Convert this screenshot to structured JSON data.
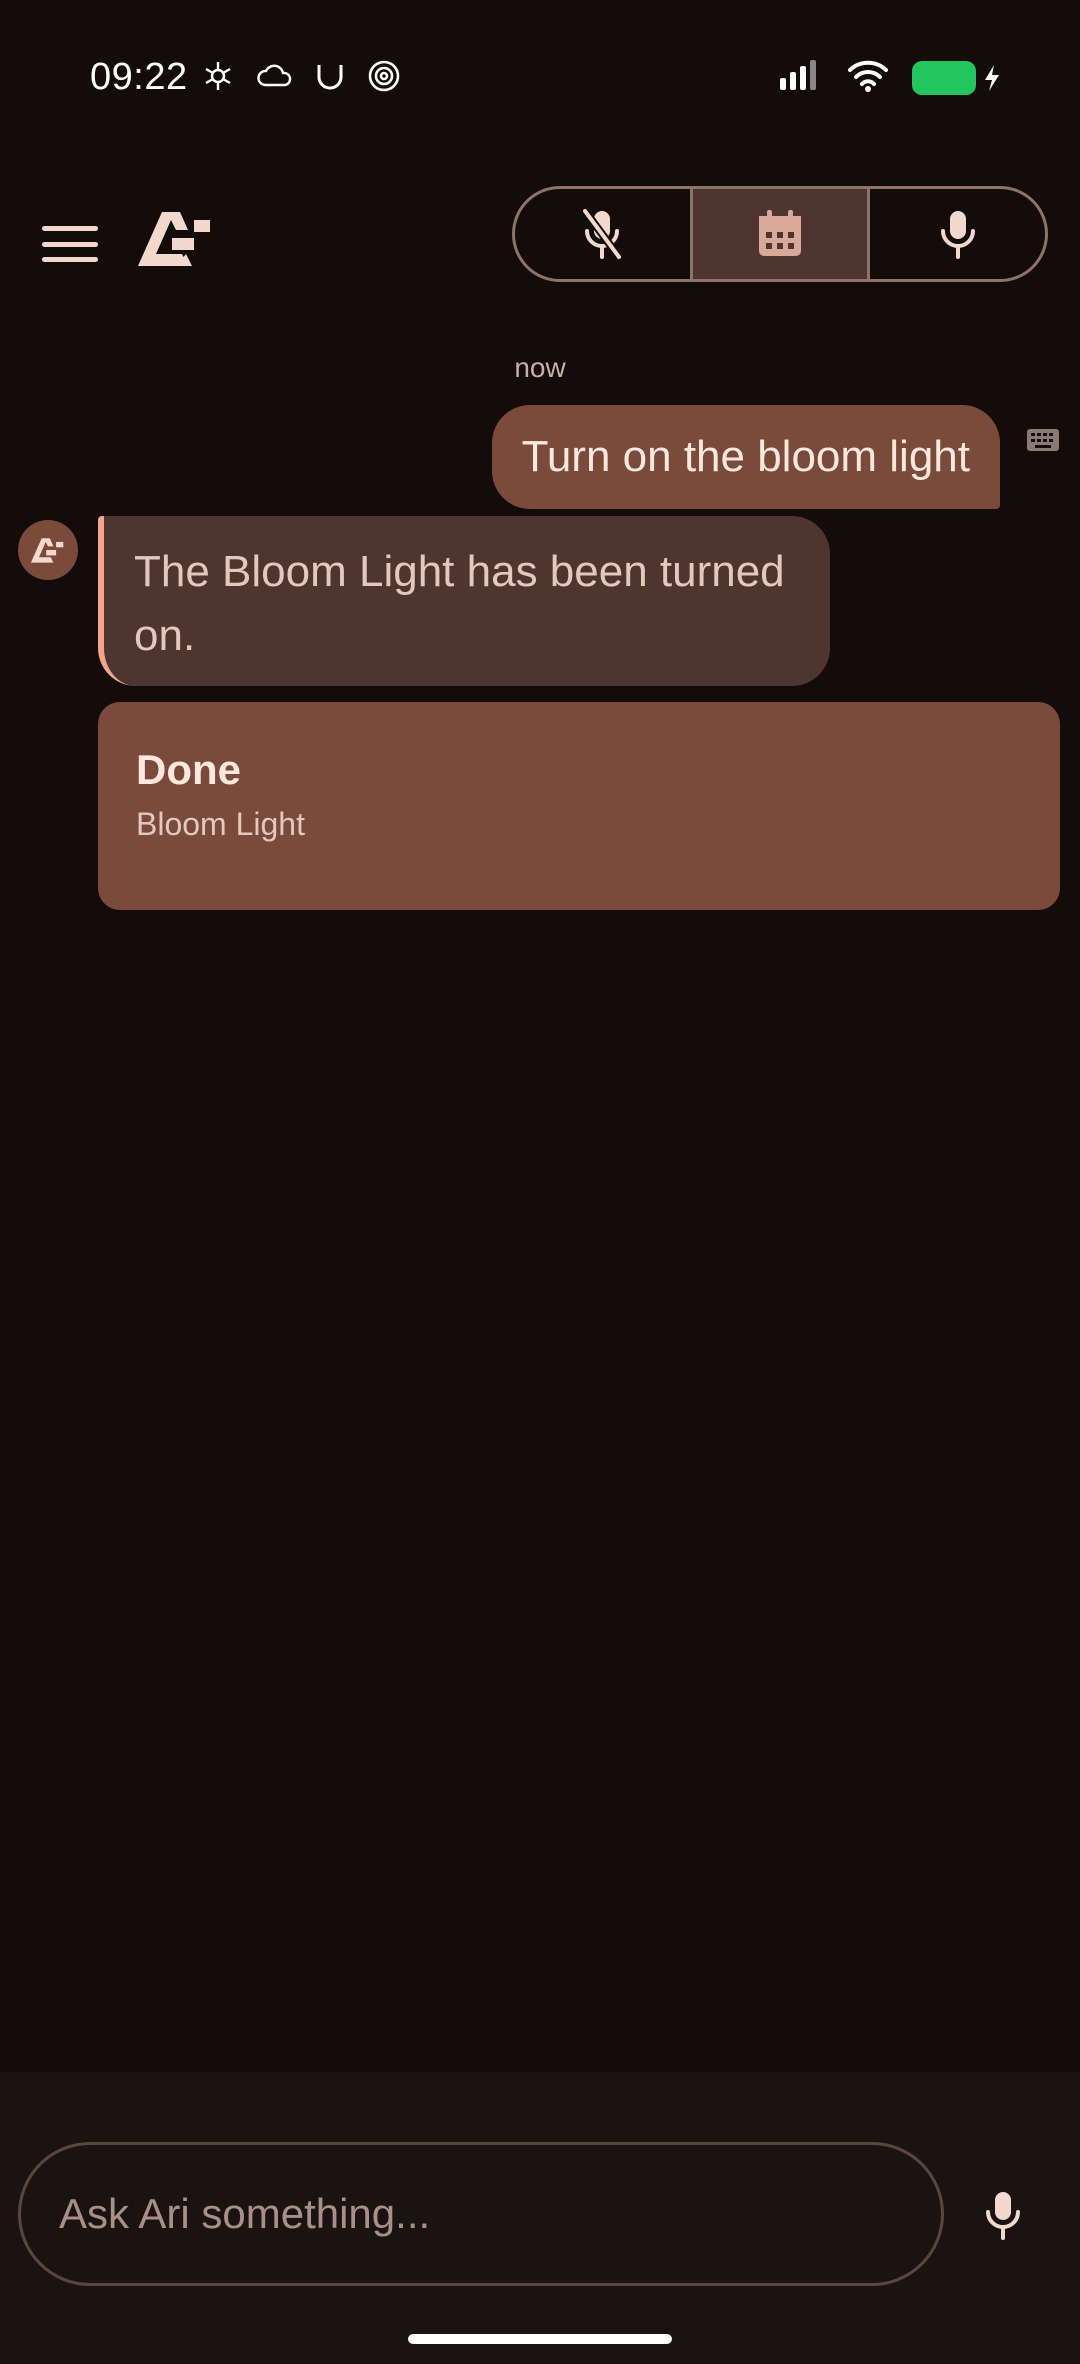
{
  "status_bar": {
    "time": "09:22",
    "left_icons": [
      "openai-icon",
      "cloud-icon",
      "u-app-icon",
      "spiral-icon"
    ],
    "right_icons": [
      "signal-icon",
      "wifi-icon",
      "battery-charging-icon"
    ],
    "battery_color": "#22c55e"
  },
  "header": {
    "menu_icon": "hamburger-menu-icon",
    "logo_icon": "ari-logo-icon",
    "mode_buttons": [
      {
        "name": "mic-muted",
        "icon": "mic-off-icon",
        "active": false
      },
      {
        "name": "calendar",
        "icon": "calendar-icon",
        "active": true
      },
      {
        "name": "mic",
        "icon": "mic-icon",
        "active": false
      }
    ]
  },
  "chat": {
    "timestamp": "now",
    "user_message": "Turn on the bloom light",
    "user_input_icon": "keyboard-icon",
    "assistant_message": "The Bloom Light has been turned on.",
    "result_card": {
      "title": "Done",
      "subtitle": "Bloom Light"
    }
  },
  "composer": {
    "placeholder": "Ask Ari something...",
    "value": "",
    "mic_icon": "mic-icon"
  },
  "colors": {
    "background": "#130c0b",
    "accent": "#7a4a3b",
    "assistant_bubble": "#4e3530",
    "accent_border": "#f2a48f",
    "text": "#f3d9cd"
  }
}
